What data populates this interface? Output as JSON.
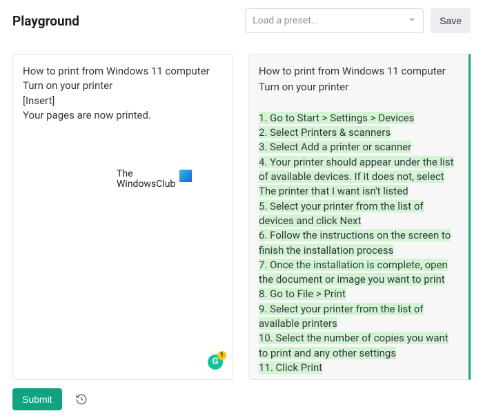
{
  "header": {
    "title": "Playground",
    "preset_placeholder": "Load a preset...",
    "save_label": "Save"
  },
  "left_panel": {
    "lines": [
      "How to print from Windows 11 computer",
      "Turn on your printer",
      "[Insert]",
      "Your pages are now printed."
    ],
    "watermark": {
      "line1": "The",
      "line2": "WindowsClub"
    },
    "grammarly_badge": "1",
    "grammarly_letter": "G"
  },
  "right_panel": {
    "intro": [
      "How to print from Windows 11 computer",
      "Turn on your printer"
    ],
    "steps": [
      "1. Go to Start > Settings > Devices",
      "2. Select Printers & scanners",
      "3. Select Add a printer or scanner",
      "4. Your printer should appear under the list of available devices. If it does not, select The printer that I want isn't listed",
      "5. Select your printer from the list of devices and click Next",
      "6. Follow the instructions on the screen to finish the installation process",
      "7. Once the installation is complete, open the document or image you want to print",
      "8. Go to File > Print",
      "9. Select your printer from the list of available printers",
      "10. Select the number of copies you want to print and any other settings",
      "11. Click Print"
    ]
  },
  "footer": {
    "submit_label": "Submit"
  }
}
